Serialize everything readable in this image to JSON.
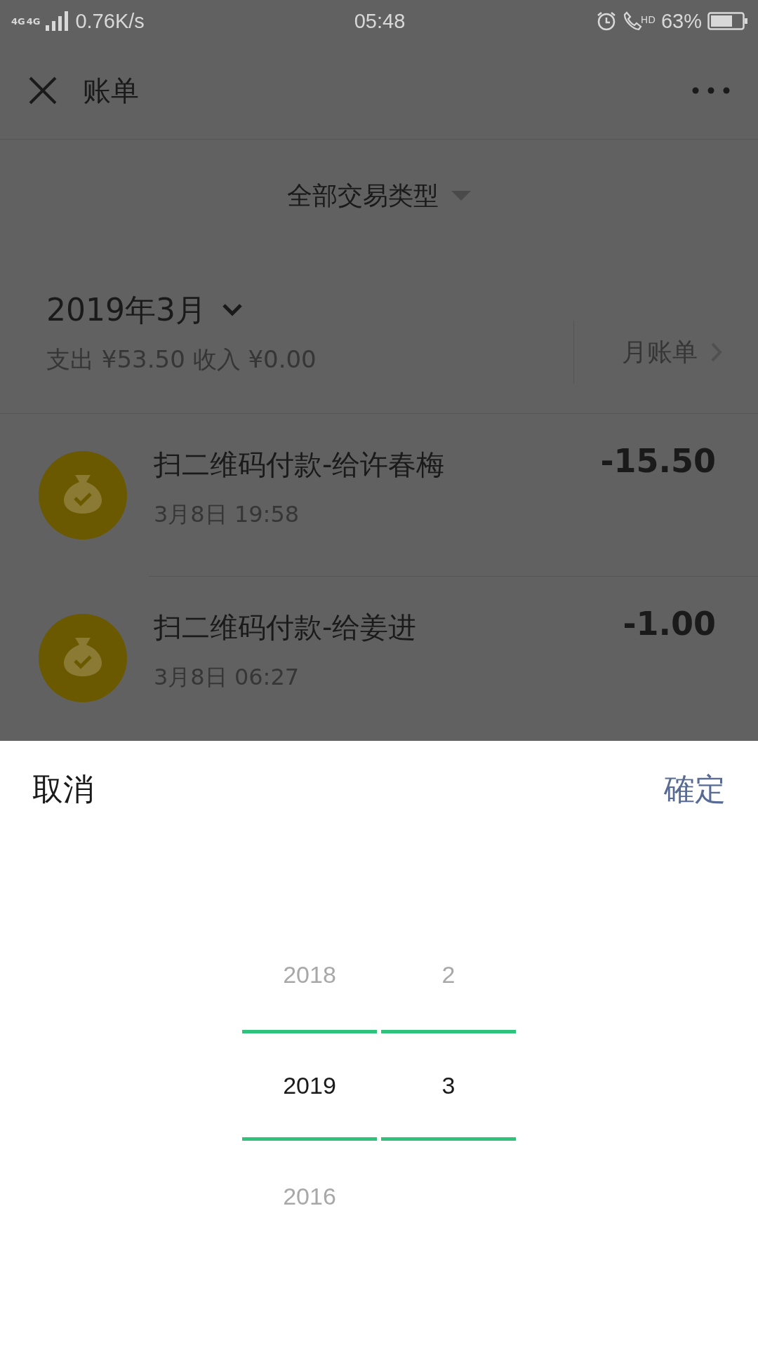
{
  "status_bar": {
    "network": [
      "4G",
      "4G"
    ],
    "speed": "0.76K/s",
    "time": "05:48",
    "call_label": "HD",
    "battery": "63%"
  },
  "header": {
    "title": "账单"
  },
  "filter": {
    "label": "全部交易类型"
  },
  "month": {
    "title": "2019年3月",
    "summary": "支出 ¥53.50 收入 ¥0.00",
    "link": "月账单"
  },
  "transactions": [
    {
      "title": "扫二维码付款-给许春梅",
      "time": "3月8日 19:58",
      "amount": "-15.50"
    },
    {
      "title": "扫二维码付款-给姜进",
      "time": "3月8日 06:27",
      "amount": "-1.00"
    }
  ],
  "sheet": {
    "cancel": "取消",
    "confirm": "確定",
    "columns": [
      {
        "items": [
          {
            "label": "2018",
            "selected": false
          },
          {
            "label": "2019",
            "selected": true
          },
          {
            "label": "2016",
            "selected": false
          }
        ]
      },
      {
        "items": [
          {
            "label": "2",
            "selected": false
          },
          {
            "label": "3",
            "selected": true
          }
        ]
      }
    ]
  }
}
